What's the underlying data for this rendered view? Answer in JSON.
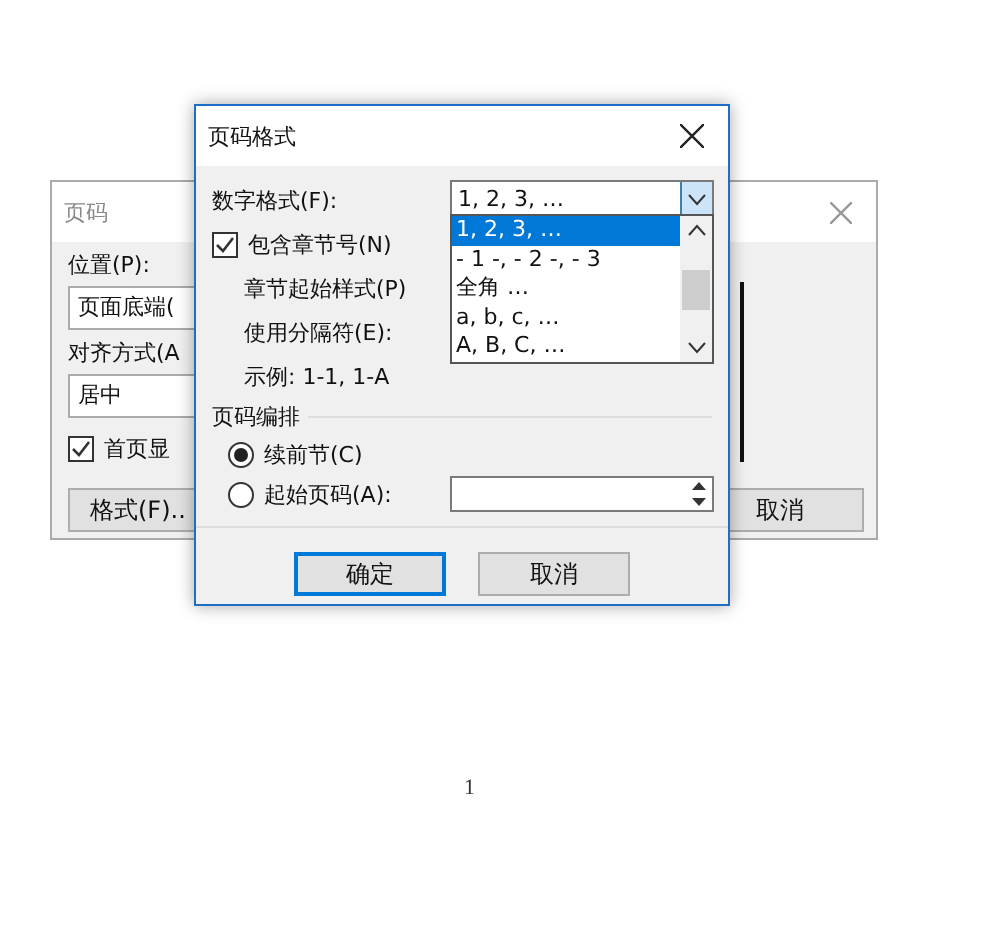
{
  "back_dialog": {
    "title": "页码",
    "position_label": "位置(P):",
    "position_value": "页面底端(",
    "alignment_label": "对齐方式(A",
    "alignment_value": "居中",
    "first_page": {
      "label": "首页显",
      "checked": true
    },
    "format_button": "格式(F)..",
    "cancel_button": "取消"
  },
  "dialog": {
    "title": "页码格式",
    "number_format": {
      "label": "数字格式(F):",
      "value": "1, 2, 3, …",
      "options": [
        {
          "label": "1, 2, 3, …",
          "selected": true
        },
        {
          "label": "- 1 -, - 2 -, - 3",
          "selected": false
        },
        {
          "label": "全角 …",
          "selected": false
        },
        {
          "label": "a, b, c, …",
          "selected": false
        },
        {
          "label": "A, B, C, …",
          "selected": false
        }
      ]
    },
    "include_chapter": {
      "label": "包含章节号(N)",
      "checked": true
    },
    "chapter_style_label": "章节起始样式(P)",
    "separator_label": "使用分隔符(E):",
    "example": "示例:  1-1, 1-A",
    "numbering": {
      "title": "页码编排",
      "options": [
        {
          "label": "续前节(C)",
          "selected": true
        },
        {
          "label": "起始页码(A):",
          "selected": false
        }
      ]
    },
    "buttons": [
      {
        "label": "确定",
        "default": true
      },
      {
        "label": "取消",
        "default": false
      }
    ]
  },
  "page_number": "1"
}
